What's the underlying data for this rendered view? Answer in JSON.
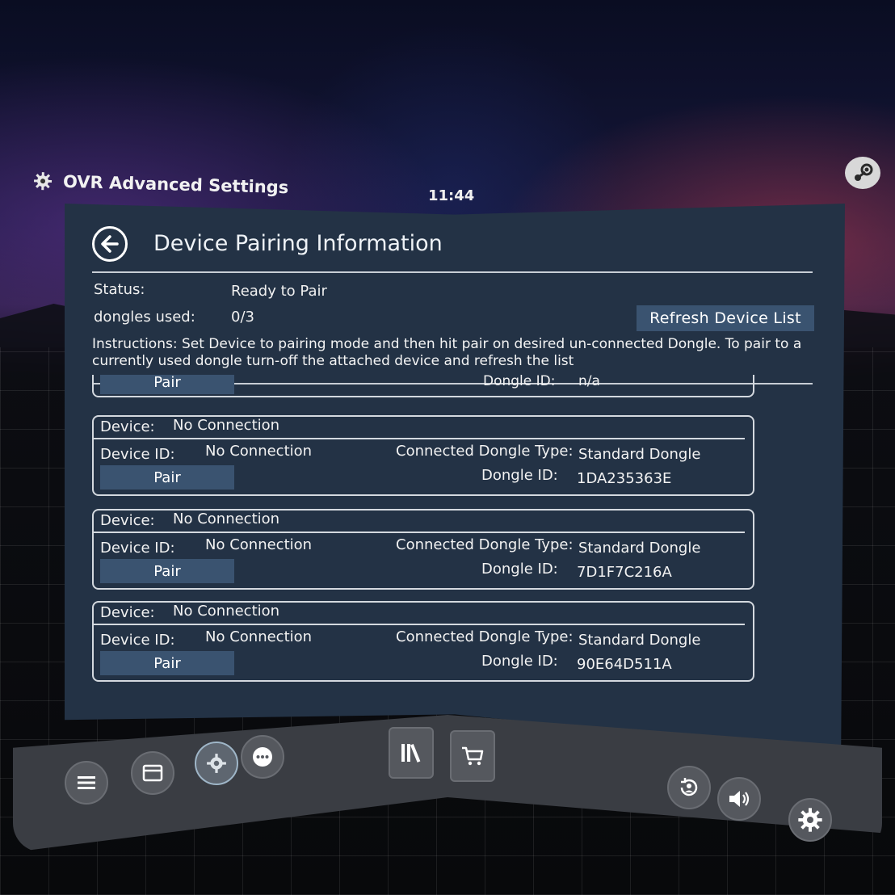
{
  "header": {
    "app_title": "OVR Advanced Settings",
    "time": "11:44",
    "app_icon": "gear-icon",
    "steam_icon": "steam-icon"
  },
  "page": {
    "title": "Device Pairing Information",
    "back_icon": "back-arrow-icon"
  },
  "status": {
    "label": "Status:",
    "value": "Ready to Pair",
    "dongles_label": "dongles used:",
    "dongles_value": "0/3"
  },
  "refresh_button": "Refresh Device List",
  "instructions": "Instructions: Set Device to pairing mode and then hit pair on desired un-connected Dongle. To pair to a currently used dongle turn-off the attached device and refresh the list",
  "partial_card": {
    "pair_label": "Pair",
    "dongle_id_label": "Dongle ID:",
    "dongle_id_value": "n/a"
  },
  "devices": [
    {
      "device_label": "Device:",
      "device_value": "No Connection",
      "device_id_label": "Device ID:",
      "device_id_value": "No Connection",
      "dongle_type_label": "Connected Dongle Type:",
      "dongle_type_value": "Standard Dongle",
      "dongle_id_label": "Dongle ID:",
      "dongle_id_value": "1DA235363E",
      "pair_label": "Pair"
    },
    {
      "device_label": "Device:",
      "device_value": "No Connection",
      "device_id_label": "Device ID:",
      "device_id_value": "No Connection",
      "dongle_type_label": "Connected Dongle Type:",
      "dongle_type_value": "Standard Dongle",
      "dongle_id_label": "Dongle ID:",
      "dongle_id_value": "7D1F7C216A",
      "pair_label": "Pair"
    },
    {
      "device_label": "Device:",
      "device_value": "No Connection",
      "device_id_label": "Device ID:",
      "device_id_value": "No Connection",
      "dongle_type_label": "Connected Dongle Type:",
      "dongle_type_value": "Standard Dongle",
      "dongle_id_label": "Dongle ID:",
      "dongle_id_value": "90E64D511A",
      "pair_label": "Pair"
    }
  ],
  "dashboard": {
    "left_buttons": [
      "menu-icon",
      "window-icon",
      "ovr-settings-icon",
      "more-icon"
    ],
    "center_buttons": [
      "library-icon",
      "store-icon"
    ],
    "right_buttons": [
      "recenter-icon",
      "volume-icon",
      "settings-gear-icon"
    ]
  },
  "colors": {
    "panel_bg": "#233245",
    "button_bg": "#3a5370",
    "dashboard_bg": "#3a3d43"
  }
}
